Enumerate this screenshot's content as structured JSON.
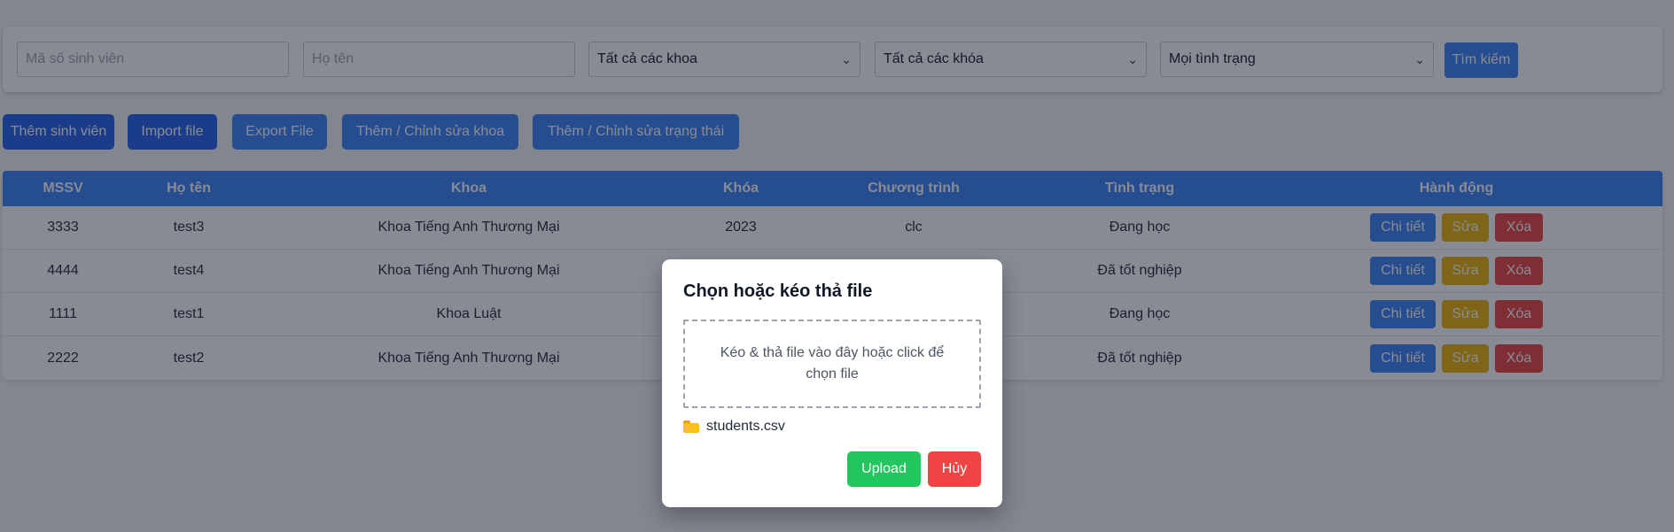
{
  "filters": {
    "student_id_placeholder": "Mã số sinh viên",
    "name_placeholder": "Họ tên",
    "faculty_select": "Tất cả các khoa",
    "course_select": "Tất cả các khóa",
    "status_select": "Mọi tình trạng",
    "search_label": "Tìm kiếm"
  },
  "actions": {
    "add_student": "Thêm sinh viên",
    "import_file": "Import file",
    "export_file": "Export File",
    "edit_faculty": "Thêm / Chỉnh sửa khoa",
    "edit_status": "Thêm / Chỉnh sửa trạng thái"
  },
  "table": {
    "headers": [
      "MSSV",
      "Họ tên",
      "Khoa",
      "Khóa",
      "Chương trình",
      "Tình trạng",
      "Hành động"
    ],
    "rows": [
      {
        "mssv": "3333",
        "name": "test3",
        "faculty": "Khoa Tiếng Anh Thương Mại",
        "course": "2023",
        "program": "clc",
        "status": "Đang học"
      },
      {
        "mssv": "4444",
        "name": "test4",
        "faculty": "Khoa Tiếng Anh Thương Mại",
        "course": "",
        "program": "",
        "status": "Đã tốt nghiệp"
      },
      {
        "mssv": "1111",
        "name": "test1",
        "faculty": "Khoa Luật",
        "course": "",
        "program": "",
        "status": "Đang học"
      },
      {
        "mssv": "2222",
        "name": "test2",
        "faculty": "Khoa Tiếng Anh Thương Mại",
        "course": "",
        "program": "",
        "status": "Đã tốt nghiệp"
      }
    ],
    "row_actions": {
      "detail": "Chi tiết",
      "edit": "Sửa",
      "delete": "Xóa"
    }
  },
  "modal": {
    "title": "Chọn hoặc kéo thả file",
    "dropzone_text": "Kéo & thả file vào đây hoặc click để chọn file",
    "selected_file": "students.csv",
    "upload_label": "Upload",
    "cancel_label": "Hủy"
  },
  "colors": {
    "primary": "#3b82f6",
    "warning": "#eab308",
    "danger": "#ef4444",
    "success": "#22c55e"
  }
}
